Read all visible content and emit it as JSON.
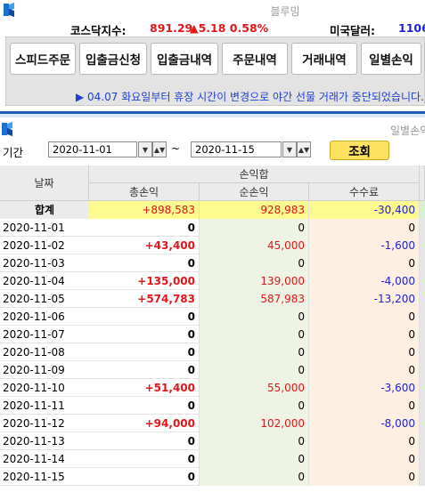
{
  "top_window": {
    "title": "블루밍"
  },
  "ticker": {
    "kosdaq_label": "코스닥지수:",
    "kosdaq_value": "891.29",
    "kosdaq_change": "▲5.18 0.58%",
    "usd_label": "미국달러:",
    "usd_value": "1106"
  },
  "toolbar": {
    "buttons": [
      "스피드주문",
      "입출금신청",
      "입출금내역",
      "주문내역",
      "거래내역",
      "일별손익"
    ]
  },
  "notice": "▶ 04.07 화요일부터 휴장 시간이 변경으로 야간 선물 거래가 중단되었습니다.",
  "sub_window": {
    "title": "일별손익"
  },
  "filter": {
    "period_label": "기간",
    "start_date": "2020-11-01",
    "end_date": "2020-11-15",
    "tilde": "~",
    "search_label": "조회"
  },
  "colors": {
    "accent": "#1e5bb5",
    "search_button": "#fde15f",
    "sum_row": "#fdfa8f",
    "profit": "#e0161b",
    "fee": "#2121d6"
  },
  "table": {
    "headers": {
      "date": "날짜",
      "group": "손익합",
      "gross": "총손익",
      "net": "순손익",
      "fee": "수수료"
    },
    "summary": {
      "label": "합계",
      "gross": "+898,583",
      "net": "928,983",
      "fee": "-30,400"
    },
    "rows": [
      {
        "date": "2020-11-01",
        "gross": "0",
        "net": "0",
        "fee": "0"
      },
      {
        "date": "2020-11-02",
        "gross": "+43,400",
        "net": "45,000",
        "fee": "-1,600"
      },
      {
        "date": "2020-11-03",
        "gross": "0",
        "net": "0",
        "fee": "0"
      },
      {
        "date": "2020-11-04",
        "gross": "+135,000",
        "net": "139,000",
        "fee": "-4,000"
      },
      {
        "date": "2020-11-05",
        "gross": "+574,783",
        "net": "587,983",
        "fee": "-13,200"
      },
      {
        "date": "2020-11-06",
        "gross": "0",
        "net": "0",
        "fee": "0"
      },
      {
        "date": "2020-11-07",
        "gross": "0",
        "net": "0",
        "fee": "0"
      },
      {
        "date": "2020-11-08",
        "gross": "0",
        "net": "0",
        "fee": "0"
      },
      {
        "date": "2020-11-09",
        "gross": "0",
        "net": "0",
        "fee": "0"
      },
      {
        "date": "2020-11-10",
        "gross": "+51,400",
        "net": "55,000",
        "fee": "-3,600"
      },
      {
        "date": "2020-11-11",
        "gross": "0",
        "net": "0",
        "fee": "0"
      },
      {
        "date": "2020-11-12",
        "gross": "+94,000",
        "net": "102,000",
        "fee": "-8,000"
      },
      {
        "date": "2020-11-13",
        "gross": "0",
        "net": "0",
        "fee": "0"
      },
      {
        "date": "2020-11-14",
        "gross": "0",
        "net": "0",
        "fee": "0"
      },
      {
        "date": "2020-11-15",
        "gross": "0",
        "net": "0",
        "fee": "0"
      }
    ]
  }
}
